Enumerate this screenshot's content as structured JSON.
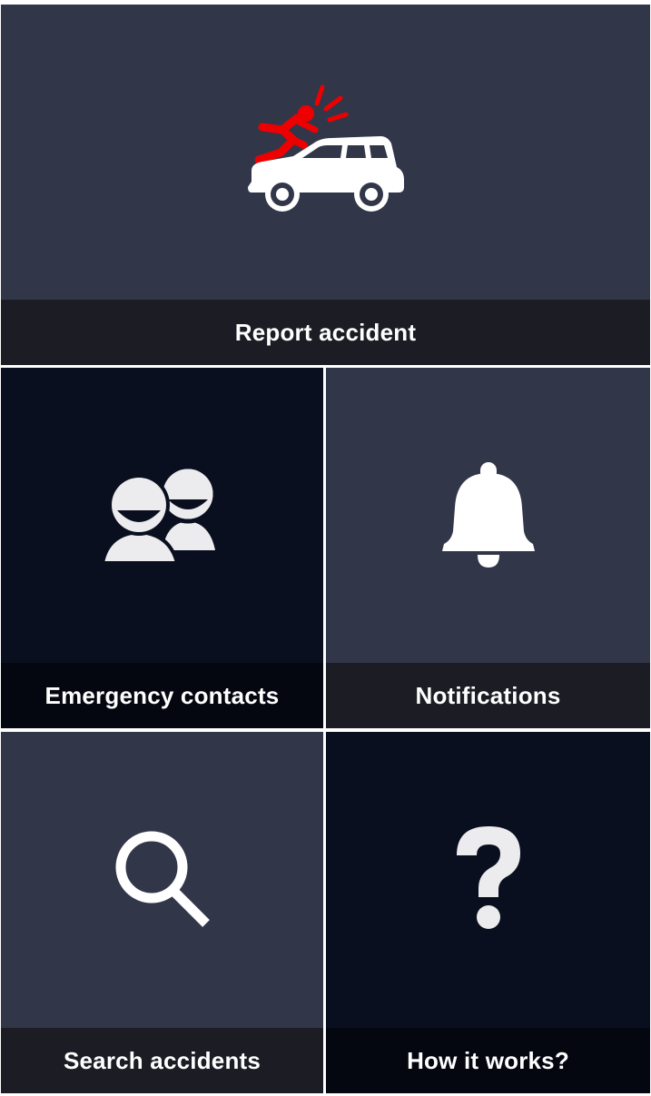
{
  "colors": {
    "tile_light": "#323649",
    "tile_dark": "#0a0f20",
    "label_light": "#1b1c24",
    "label_dark": "#040710",
    "icon": "#ffffff",
    "accent": "#ee0000"
  },
  "tiles": [
    {
      "label": "Report accident",
      "icon": "car-accident-icon"
    },
    {
      "label": "Emergency contacts",
      "icon": "contacts-icon"
    },
    {
      "label": "Notifications",
      "icon": "bell-icon"
    },
    {
      "label": "Search accidents",
      "icon": "search-icon"
    },
    {
      "label": "How it works?",
      "icon": "question-icon"
    }
  ]
}
